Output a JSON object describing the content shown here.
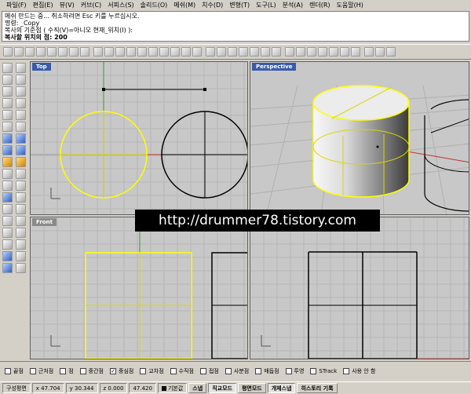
{
  "menu": [
    {
      "label": "파일(F)"
    },
    {
      "label": "편집(E)"
    },
    {
      "label": "뷰(V)"
    },
    {
      "label": "커브(C)"
    },
    {
      "label": "서피스(S)"
    },
    {
      "label": "솔리드(O)"
    },
    {
      "label": "메쉬(M)"
    },
    {
      "label": "치수(D)"
    },
    {
      "label": "변형(T)"
    },
    {
      "label": "도구(L)"
    },
    {
      "label": "분석(A)"
    },
    {
      "label": "렌더(R)"
    },
    {
      "label": "도움말(H)"
    }
  ],
  "command": {
    "history": [
      "메쉬 만드는 중... 취소하려면 Esc 키를 누르십시오.",
      "명령: _Copy",
      "복사의 기준점 ( 수직(V)=아니오  현재_위치(I) ):"
    ],
    "prompt": "복사할 위치의 점: 200"
  },
  "viewports": {
    "top": {
      "title": "Top"
    },
    "perspective": {
      "title": "Perspective"
    },
    "front": {
      "title": "Front"
    },
    "right": {
      "title": ""
    }
  },
  "watermark": "http://drummer78.tistory.com",
  "osnaps": [
    {
      "label": "끝점",
      "checked": false
    },
    {
      "label": "근처점",
      "checked": false
    },
    {
      "label": "점",
      "checked": false
    },
    {
      "label": "중간점",
      "checked": false
    },
    {
      "label": "중심점",
      "checked": true
    },
    {
      "label": "교차점",
      "checked": false
    },
    {
      "label": "수직점",
      "checked": false
    },
    {
      "label": "접점",
      "checked": false
    },
    {
      "label": "사분점",
      "checked": false
    },
    {
      "label": "매듭점",
      "checked": false
    },
    {
      "label": "투영",
      "checked": false
    },
    {
      "label": "STrack",
      "checked": false
    },
    {
      "label": "사용 안 함",
      "checked": false
    }
  ],
  "status": {
    "cplane": "구성평면",
    "x": "x 47.704",
    "y": "y 30.344",
    "z": "z 0.000",
    "distance": "47.420",
    "layer": "기본값",
    "snap": "스냅",
    "ortho": "직교모드",
    "planar": "평면모드",
    "osnap": "개체스냅",
    "history": "히스토리 기록"
  },
  "colors": {
    "selected": "#ffff00",
    "curve": "#000000",
    "x_axis": "#c03030",
    "y_axis": "#30a030",
    "active_title": "#3a5ba8"
  }
}
